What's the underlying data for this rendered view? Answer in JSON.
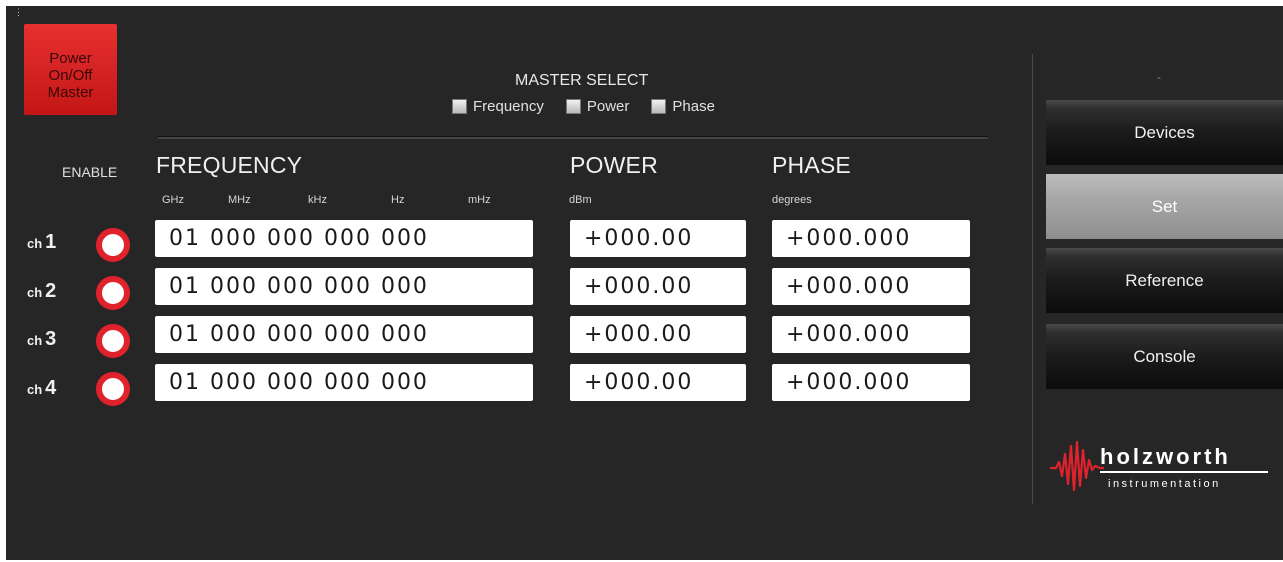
{
  "power_button": {
    "lines": [
      "Power",
      "On/Off",
      "Master"
    ]
  },
  "master_select": {
    "title": "MASTER SELECT",
    "options": [
      {
        "label": "Frequency",
        "checked": false
      },
      {
        "label": "Power",
        "checked": false
      },
      {
        "label": "Phase",
        "checked": false
      }
    ]
  },
  "enable_label": "ENABLE",
  "headers": {
    "frequency": "FREQUENCY",
    "power": "POWER",
    "phase": "PHASE"
  },
  "frequency_units": [
    "GHz",
    "MHz",
    "kHz",
    "Hz",
    "mHz"
  ],
  "power_unit": "dBm",
  "phase_unit": "degrees",
  "channels": [
    {
      "prefix": "ch",
      "number": "1",
      "enabled": true,
      "frequency": "01 000 000 000 000",
      "power": "+000.00",
      "phase": "+000.000"
    },
    {
      "prefix": "ch",
      "number": "2",
      "enabled": true,
      "frequency": "01 000 000 000 000",
      "power": "+000.00",
      "phase": "+000.000"
    },
    {
      "prefix": "ch",
      "number": "3",
      "enabled": true,
      "frequency": "01 000 000 000 000",
      "power": "+000.00",
      "phase": "+000.000"
    },
    {
      "prefix": "ch",
      "number": "4",
      "enabled": true,
      "frequency": "01 000 000 000 000",
      "power": "+000.00",
      "phase": "+000.000"
    }
  ],
  "status_dash": "-",
  "nav": [
    {
      "label": "Devices",
      "active": false
    },
    {
      "label": "Set",
      "active": true
    },
    {
      "label": "Reference",
      "active": false
    },
    {
      "label": "Console",
      "active": false
    }
  ],
  "logo": {
    "name": "holzworth",
    "sub": "instrumentation"
  },
  "colors": {
    "background": "#262626",
    "power_red": "#d82020",
    "led_red": "#e0222c",
    "logo_wave": "#e0222c"
  }
}
